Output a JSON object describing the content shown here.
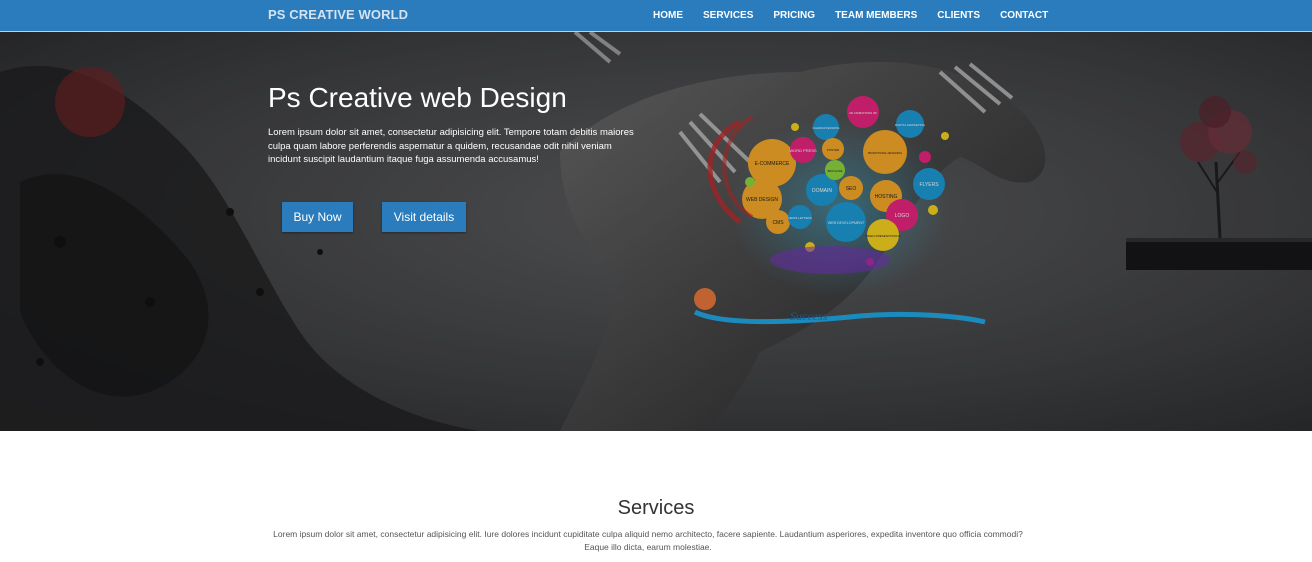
{
  "navbar": {
    "brand": "PS CREATIVE WORLD",
    "links": [
      "HOME",
      "SERVICES",
      "PRICING",
      "TEAM MEMBERS",
      "CLIENTS",
      "CONTACT"
    ],
    "color": "#2a7cbd"
  },
  "hero": {
    "title": "Ps Creative web Design",
    "text": "Lorem ipsum dolor sit amet, consectetur adipisicing elit. Tempore totam debitis maiores culpa quam labore perferendis aspernatur a quidem, recusandae odit nihil veniam incidunt suscipit laudantium itaque fuga assumenda accusamus!",
    "buy_label": "Buy Now",
    "visit_label": "Visit details",
    "bubbles": [
      "E-COMMERCE",
      "WORD PRESS",
      "WEB DESIGN",
      "DOMAIN",
      "SEO",
      "HOSTING",
      "LOGO",
      "FLYERS",
      "CMS",
      "WEB DEVELOPMENT",
      "VIDEO PRESENTATIONS",
      "DIGITAL MARKETING",
      "PROMOTIONAL DESIGNING",
      "2D ANIMATIONS 3D",
      "CALENDAR DESIGNING",
      "NEWS LETTERS",
      "POSTER",
      "BROCHURE"
    ],
    "swoosh_text": "Success"
  },
  "services": {
    "title": "Services",
    "text": "Lorem ipsum dolor sit amet, consectetur adipisicing elit. Iure dolores incidunt cupiditate culpa aliquid nemo architecto, facere sapiente. Laudantium asperiores, expedita inventore quo officia commodi? Eaque illo dicta, earum molestiae."
  }
}
